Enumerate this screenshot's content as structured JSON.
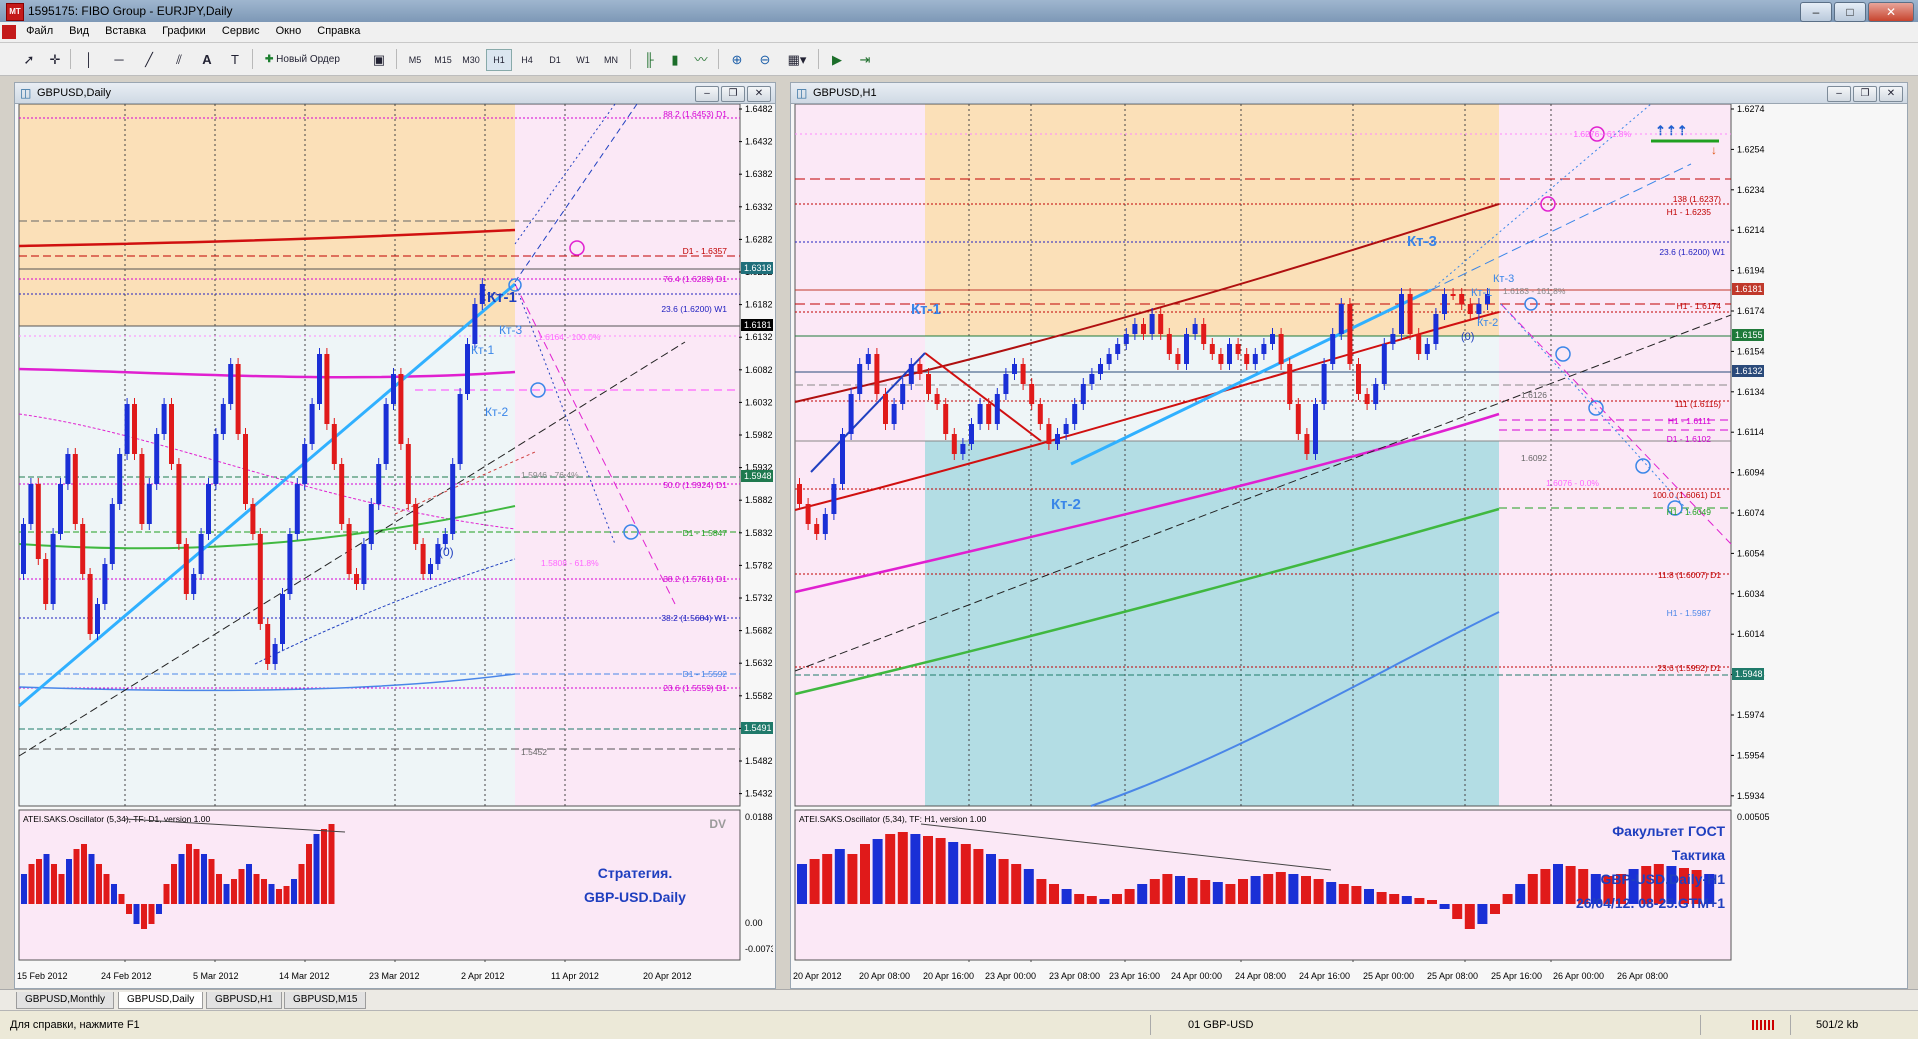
{
  "window": {
    "title": "1595175: FIBO Group - EURJPY,Daily",
    "icon_name": "terminal-icon",
    "controls": [
      "minimize-icon",
      "maximize-icon",
      "close-icon"
    ]
  },
  "menu": [
    "Файл",
    "Вид",
    "Вставка",
    "Графики",
    "Сервис",
    "Окно",
    "Справка"
  ],
  "toolbar": {
    "new_order_label": "Новый Ордер",
    "timeframes": [
      "M5",
      "M15",
      "M30",
      "H1",
      "H4",
      "D1",
      "W1",
      "MN"
    ],
    "selected_timeframe": "H1"
  },
  "left_chart": {
    "title": "GBPUSD,Daily",
    "price_labels": [
      "1.6482",
      "1.6432",
      "1.6382",
      "1.6332",
      "1.6282",
      "1.6232",
      "1.6182",
      "1.6132",
      "1.6082",
      "1.6032",
      "1.5982",
      "1.5932",
      "1.5882",
      "1.5832",
      "1.5782",
      "1.5732",
      "1.5682",
      "1.5632",
      "1.5582",
      "1.5532",
      "1.5482",
      "1.5432"
    ],
    "price_tags": [
      {
        "value": "1.6318",
        "color": "#1f6f7a"
      },
      {
        "value": "1.6181",
        "color": "#000000"
      },
      {
        "value": "1.5948",
        "color": "#1f7a4f"
      },
      {
        "value": "1.5491",
        "color": "#1f7a6a"
      }
    ],
    "level_labels": [
      {
        "text": "88.2 (1.6453) D1",
        "color": "#d400d4"
      },
      {
        "text": "D1 - 1.6357",
        "color": "#c00000"
      },
      {
        "text": "76.4 (1.6289) D1",
        "color": "#d400d4"
      },
      {
        "text": "23.6 (1.6200) W1",
        "color": "#2020c0"
      },
      {
        "text": "1.6164 - 100.0%",
        "color": "#ff66ff"
      },
      {
        "text": "1.5946 - 76.4%",
        "color": "#888888"
      },
      {
        "text": "50.0 (1.5924) D1",
        "color": "#d400d4"
      },
      {
        "text": "D1 - 1.5847",
        "color": "#20a020"
      },
      {
        "text": "1.5808 - 61.8%",
        "color": "#ff66ff"
      },
      {
        "text": "38.2 (1.5761) D1",
        "color": "#d400d4"
      },
      {
        "text": "38.2 (1.5684) W1",
        "color": "#2020c0"
      },
      {
        "text": "D1 - 1.5592",
        "color": "#4a86e8"
      },
      {
        "text": "23.6 (1.5559) D1",
        "color": "#d400d4"
      },
      {
        "text": "1.5452",
        "color": "#666666"
      }
    ],
    "annotations": [
      "Кт-1",
      "Кт-3",
      "Кт-1",
      "Кт-2",
      "(0)"
    ],
    "indicator_title": "ATEI.SAKS.Oscillator (5,34), TF: D1, version 1.00",
    "indicator_scale": [
      "0.01887",
      "0.00",
      "-0.00736"
    ],
    "indicator_text": [
      "DV",
      "Стратегия.",
      "GBP-USD.Daily"
    ],
    "time_labels": [
      "15 Feb 2012",
      "24 Feb 2012",
      "5 Mar 2012",
      "14 Mar 2012",
      "23 Mar 2012",
      "2 Apr 2012",
      "11 Apr 2012",
      "20 Apr 2012"
    ]
  },
  "right_chart": {
    "title": "GBPUSD,H1",
    "price_labels": [
      "1.6274",
      "1.6254",
      "1.6234",
      "1.6214",
      "1.6194",
      "1.6174",
      "1.6154",
      "1.6134",
      "1.6114",
      "1.6094",
      "1.6074",
      "1.6054",
      "1.6034",
      "1.6014",
      "1.5994",
      "1.5974",
      "1.5954",
      "1.5934"
    ],
    "price_tags": [
      {
        "value": "1.6181",
        "color": "#c0392b"
      },
      {
        "value": "1.6155",
        "color": "#1f7a3a"
      },
      {
        "value": "1.6132",
        "color": "#2a4a7a"
      },
      {
        "value": "1.5948",
        "color": "#1f7a6a"
      }
    ],
    "level_labels": [
      {
        "text": "1.6276 - 61.8%",
        "color": "#ff66ff"
      },
      {
        "text": "138 (1.6237)",
        "color": "#c00000"
      },
      {
        "text": "H1 - 1.6235",
        "color": "#c00000"
      },
      {
        "text": "23.6 (1.6200) W1",
        "color": "#2020c0"
      },
      {
        "text": "1.6183 - 161.8%",
        "color": "#888888"
      },
      {
        "text": "H1 - 1.6174",
        "color": "#c00000"
      },
      {
        "text": "1.6126",
        "color": "#666666"
      },
      {
        "text": "111 (1.6115)",
        "color": "#c00000"
      },
      {
        "text": "H1 - 1.6111",
        "color": "#d400d4"
      },
      {
        "text": "D1 - 1.6102",
        "color": "#d400d4"
      },
      {
        "text": "1.6092",
        "color": "#666666"
      },
      {
        "text": "1.6076 - 0.0%",
        "color": "#ff66ff"
      },
      {
        "text": "100.0 (1.6061) D1",
        "color": "#c00000"
      },
      {
        "text": "H1 - 1.6049",
        "color": "#20a020"
      },
      {
        "text": "11.8 (1.6007) D1",
        "color": "#c00000"
      },
      {
        "text": "H1 - 1.5987",
        "color": "#4a86e8"
      },
      {
        "text": "23.6 (1.5952) D1",
        "color": "#c00000"
      }
    ],
    "annotations": [
      "Кт-1",
      "Кт-2",
      "Кт-3",
      "Кт-3",
      "Кт-1",
      "Кт-2",
      "(0)"
    ],
    "indicator_title": "ATEI.SAKS.Oscillator (5,34), TF: H1, version 1.00",
    "indicator_scale": [
      "0.00505"
    ],
    "indicator_text": [
      "Факультет ГОСТ",
      "Тактика",
      "GBP-USD.Daily-H1",
      "26/04/12. 08-25.GTM+1"
    ],
    "time_labels": [
      "20 Apr 2012",
      "20 Apr 08:00",
      "20 Apr 16:00",
      "23 Apr 00:00",
      "23 Apr 08:00",
      "23 Apr 16:00",
      "24 Apr 00:00",
      "24 Apr 08:00",
      "24 Apr 16:00",
      "25 Apr 00:00",
      "25 Apr 08:00",
      "25 Apr 16:00",
      "26 Apr 00:00",
      "26 Apr 08:00"
    ]
  },
  "tabs": [
    "GBPUSD,Monthly",
    "GBPUSD,Daily",
    "GBPUSD,H1",
    "GBPUSD,M15"
  ],
  "active_tab": "GBPUSD,Daily",
  "status": {
    "help": "Для справки, нажмите F1",
    "profile": "01 GBP-USD",
    "traffic": "501/2 kb"
  }
}
